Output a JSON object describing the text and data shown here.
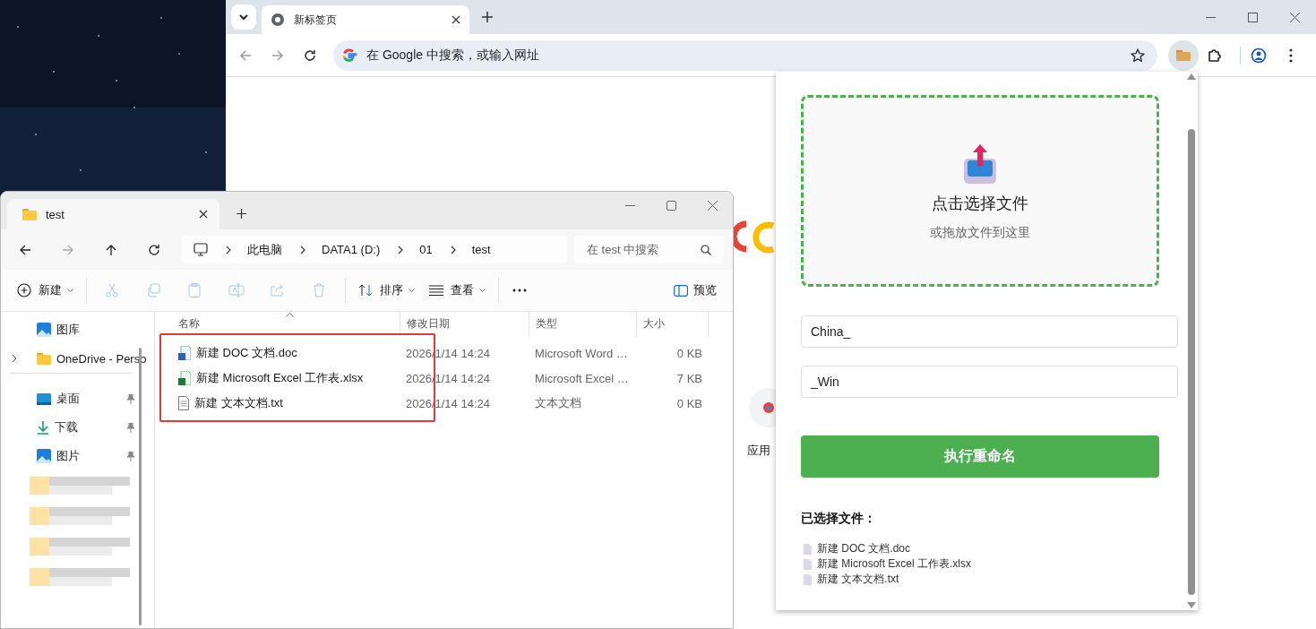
{
  "browser": {
    "tabs": [
      {
        "title": "新标签页",
        "selected": true
      }
    ],
    "address_bar": {
      "placeholder": "在 Google 中搜索，或输入网址"
    },
    "page": {
      "shortcut_label": "应用"
    }
  },
  "explorer": {
    "tabs": [
      {
        "title": "test",
        "selected": true
      }
    ],
    "breadcrumb": [
      "此电脑",
      "DATA1 (D:)",
      "01",
      "test"
    ],
    "search": {
      "placeholder": "在 test 中搜索"
    },
    "commands": [
      {
        "kind": "new",
        "label": "新建",
        "disabled": false
      },
      {
        "kind": "cut",
        "disabled": true
      },
      {
        "kind": "copy",
        "disabled": true
      },
      {
        "kind": "paste",
        "disabled": true
      },
      {
        "kind": "rename",
        "disabled": true
      },
      {
        "kind": "share",
        "disabled": true
      },
      {
        "kind": "delete",
        "disabled": true
      },
      {
        "kind": "sort",
        "label": "排序",
        "disabled": false
      },
      {
        "kind": "view",
        "label": "查看",
        "disabled": false
      },
      {
        "kind": "more",
        "disabled": false
      }
    ],
    "preview": {
      "label": "预览"
    },
    "sidebar": [
      {
        "kind": "gallery",
        "label": "图库",
        "expandable": false,
        "pinned": false
      },
      {
        "kind": "cloud",
        "label": "OneDrive - Perso",
        "expandable": true,
        "pinned": false
      },
      {
        "kind": "divider"
      },
      {
        "kind": "desktop",
        "label": "桌面",
        "expandable": false,
        "pinned": true
      },
      {
        "kind": "downloads",
        "label": "下载",
        "expandable": false,
        "pinned": true
      },
      {
        "kind": "pictures",
        "label": "图片",
        "expandable": false,
        "pinned": true
      },
      {
        "kind": "redacted"
      },
      {
        "kind": "redacted"
      },
      {
        "kind": "redacted"
      },
      {
        "kind": "redacted"
      }
    ],
    "columns": [
      "名称",
      "修改日期",
      "类型",
      "大小"
    ],
    "rows": [
      {
        "kind": "word",
        "name": "新建 DOC 文档.doc",
        "modified": "2026/1/14 14:24",
        "type": "Microsoft Word …",
        "size": "0 KB"
      },
      {
        "kind": "excel",
        "name": "新建 Microsoft Excel 工作表.xlsx",
        "modified": "2026/1/14 14:24",
        "type": "Microsoft Excel …",
        "size": "7 KB"
      },
      {
        "kind": "text",
        "name": "新建 文本文档.txt",
        "modified": "2026/1/14 14:24",
        "type": "文本文档",
        "size": "0 KB"
      }
    ]
  },
  "popup": {
    "dropzone": {
      "title": "点击选择文件",
      "hint": "或拖放文件到这里"
    },
    "fields": [
      {
        "value": "China_"
      },
      {
        "value": "_Win"
      }
    ],
    "rename_button": "执行重命名",
    "selected_heading": "已选择文件：",
    "selected_files": [
      "新建 DOC 文档.doc",
      "新建 Microsoft Excel 工作表.xlsx",
      "新建 文本文档.txt"
    ]
  }
}
